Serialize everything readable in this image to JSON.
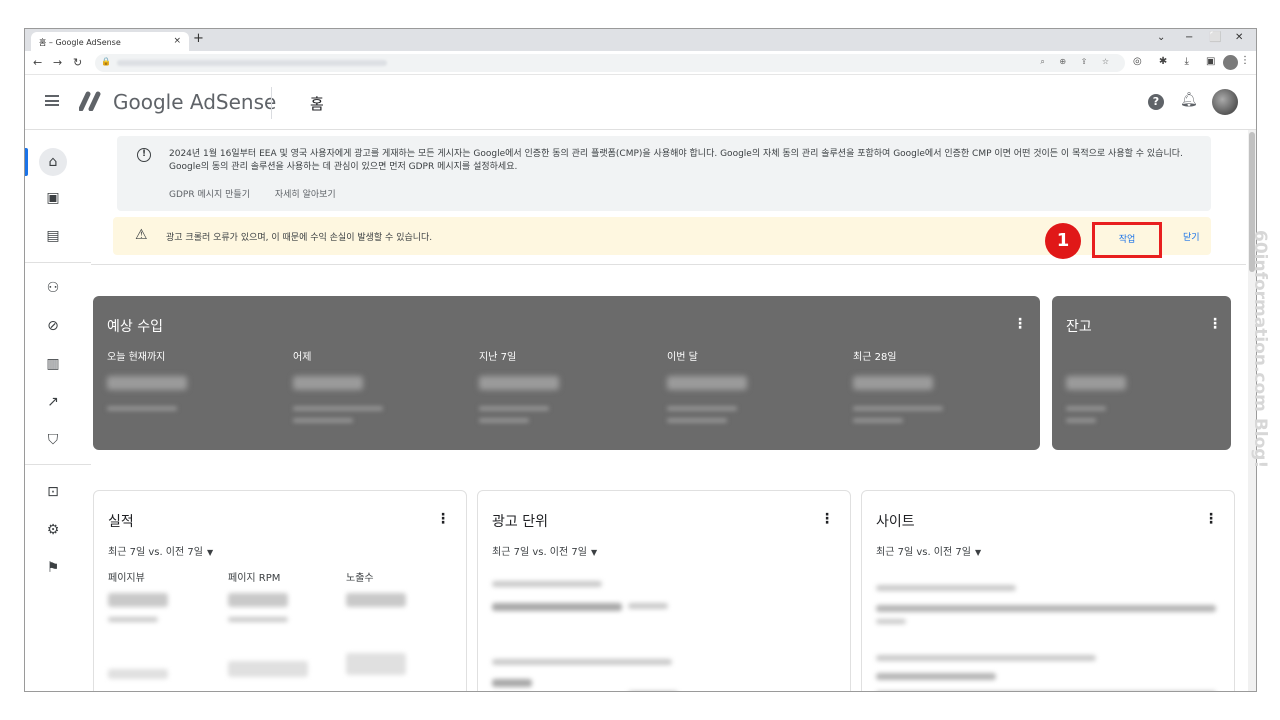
{
  "browser": {
    "tab_title": "홈 – Google AdSense",
    "tab_close": "×",
    "new_tab": "+",
    "window_controls": [
      "⌄",
      "−",
      "⬜",
      "✕"
    ]
  },
  "header": {
    "logo_text": "Google AdSense",
    "page_title": "홈",
    "help_label": "?"
  },
  "gdpr_banner": {
    "text": "2024년 1월 16일부터 EEA 및 영국 사용자에게 광고를 게재하는 모든 게시자는 Google에서 인증한 동의 관리 플랫폼(CMP)을 사용해야 합니다. Google의 자체 동의 관리 솔루션을 포함하여 Google에서 인증한 CMP 이면 어떤 것이든 이 목적으로 사용할 수 있습니다. Google의 동의 관리 솔루션을 사용하는 데 관심이 있으면 먼저 GDPR 메시지를 설정하세요.",
    "link_create": "GDPR 메시지 만들기",
    "link_learn": "자세히 알아보기"
  },
  "warning_banner": {
    "text": "광고 크롤러 오류가 있으며, 이 때문에 수익 손실이 발생할 수 있습니다.",
    "action_label": "작업",
    "close_label": "닫기",
    "annotation_number": "1"
  },
  "earnings_card": {
    "title": "예상 수입",
    "metrics": [
      "오늘 현재까지",
      "어제",
      "지난 7일",
      "이번 달",
      "최근 28일"
    ]
  },
  "balance_card": {
    "title": "잔고"
  },
  "performance_card": {
    "title": "실적",
    "range": "최근 7일 vs. 이전 7일",
    "columns": [
      "페이지뷰",
      "페이지 RPM",
      "노출수"
    ]
  },
  "ad_units_card": {
    "title": "광고 단위",
    "range": "최근 7일 vs. 이전 7일"
  },
  "sites_card": {
    "title": "사이트",
    "range": "최근 7일 vs. 이전 7일"
  },
  "watermark": "60information.com Blog!",
  "colors": {
    "accent": "#1a73e8",
    "warning_bg": "#fef7e0",
    "dark_card": "#6b6b6b",
    "highlight": "#e81f1f"
  }
}
